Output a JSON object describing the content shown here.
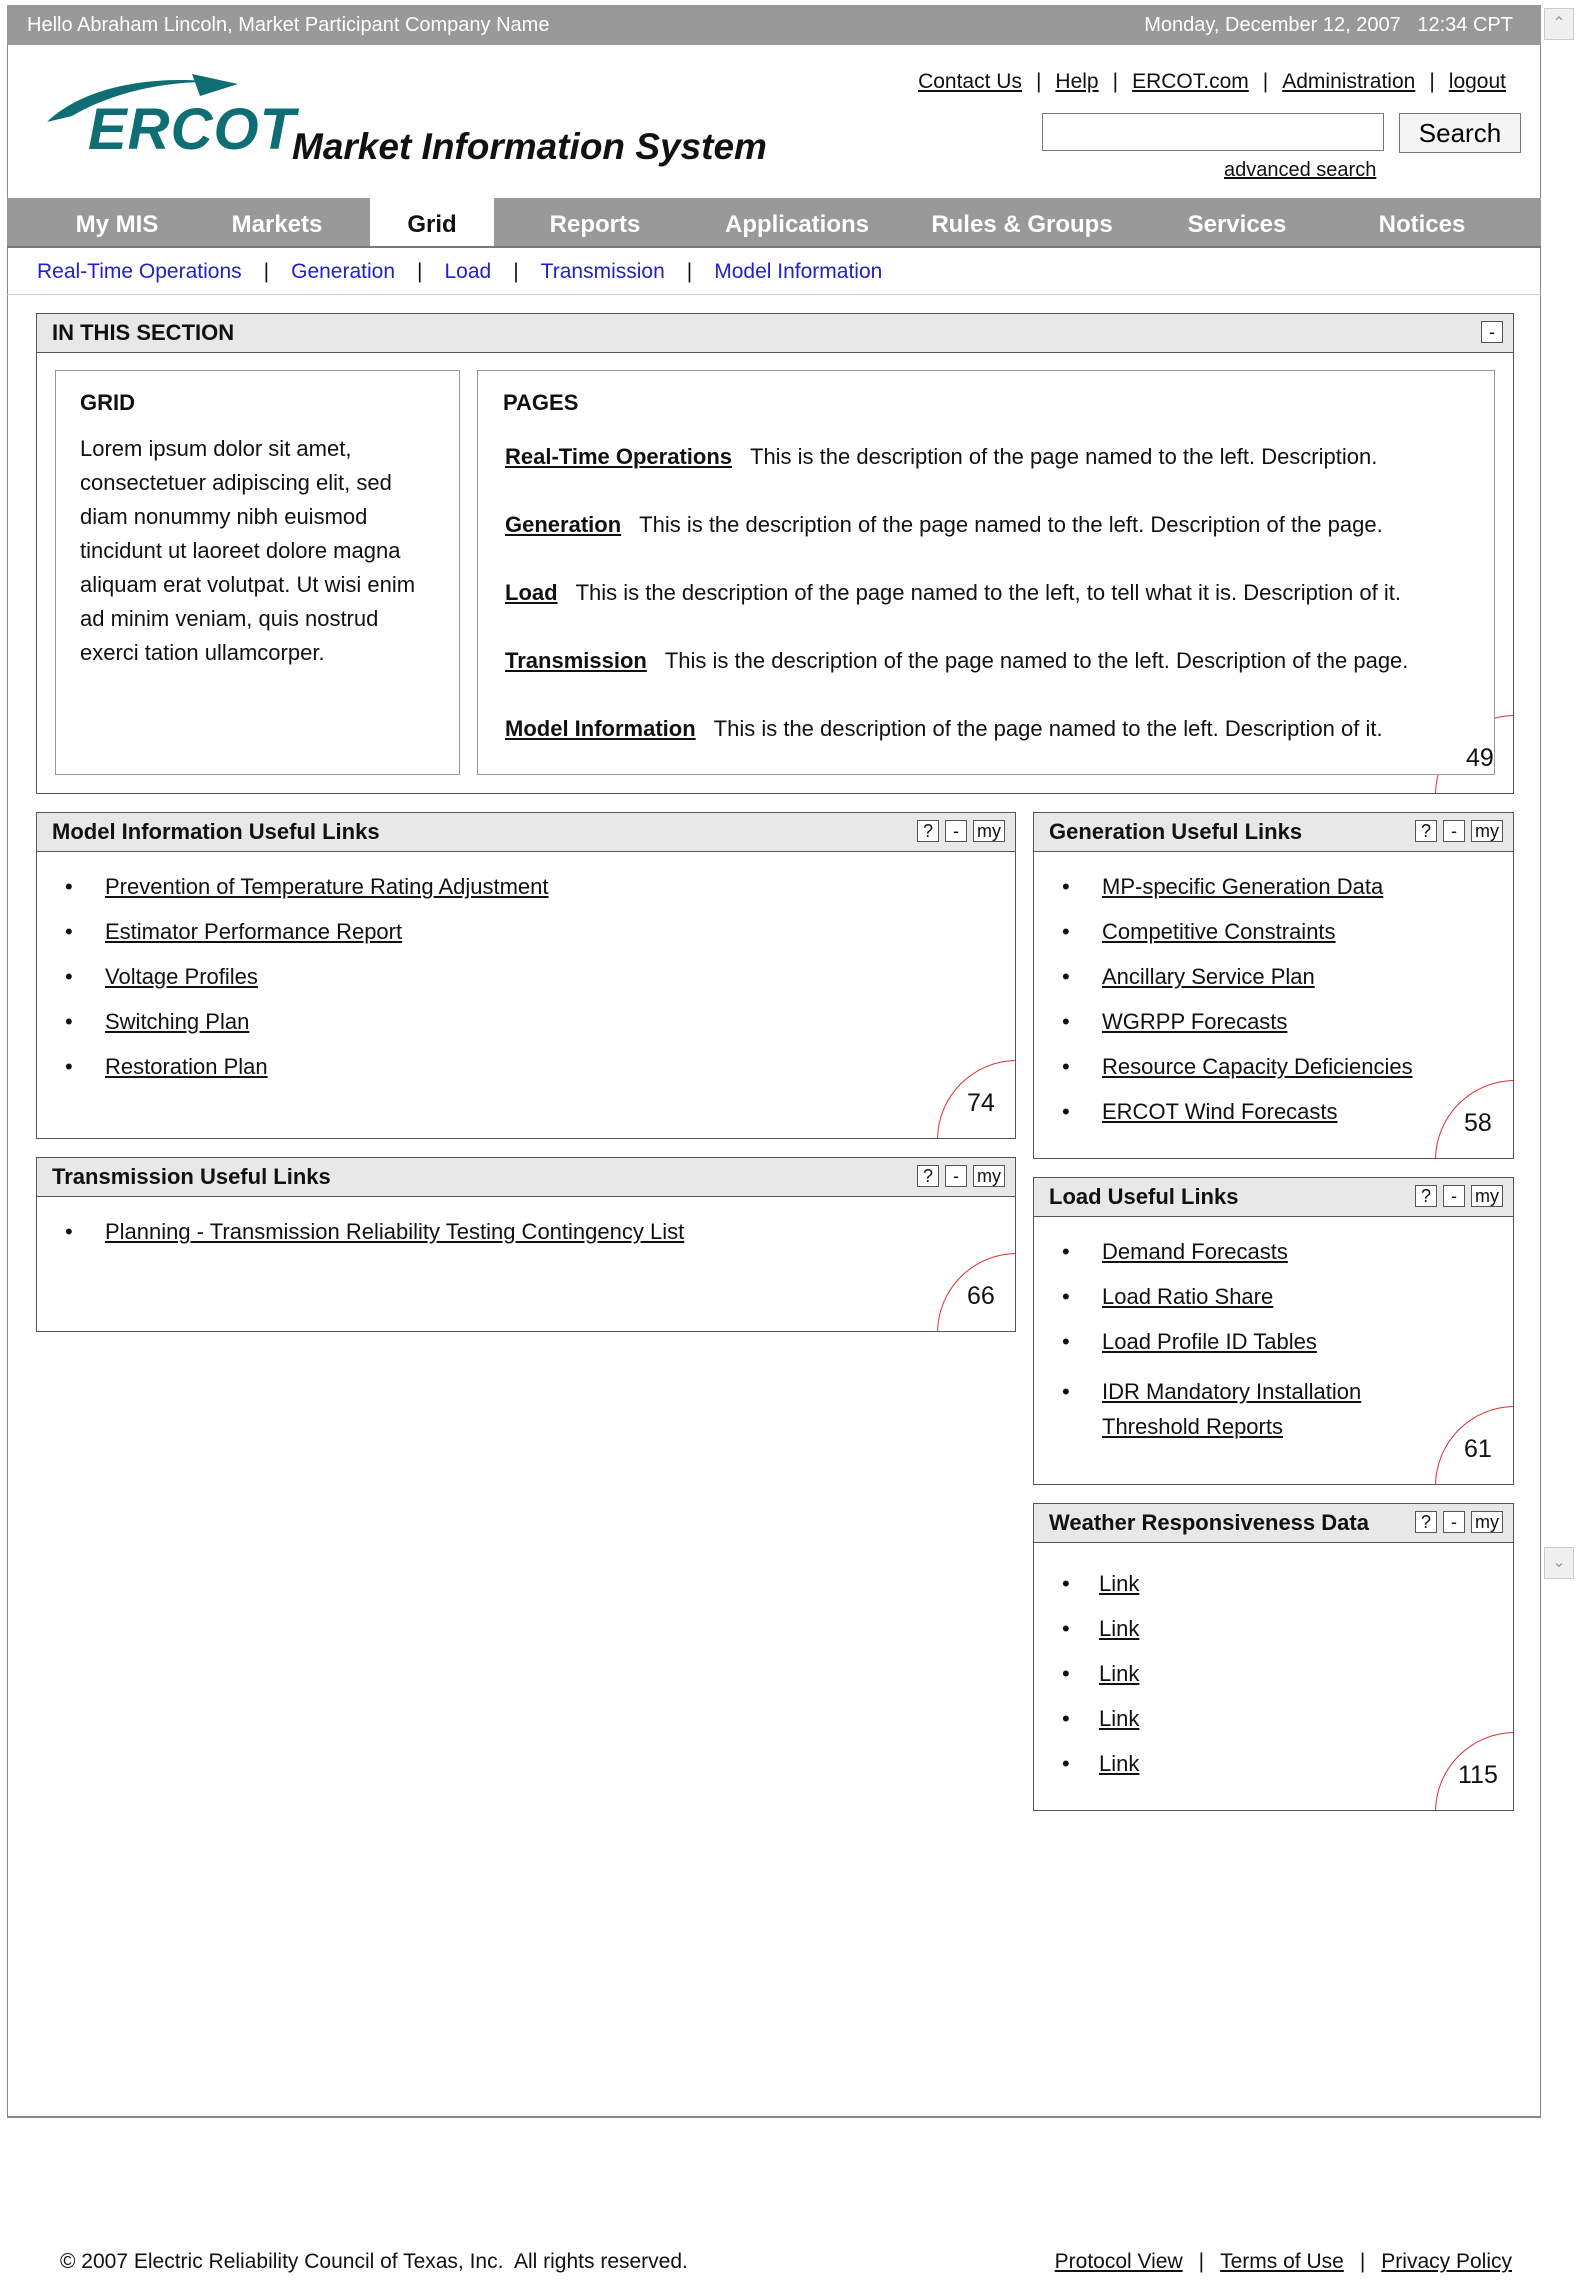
{
  "topbar": {
    "greeting": "Hello Abraham Lincoln, Market Participant Company Name",
    "datetime": "Monday, December 12, 2007   12:34 CPT"
  },
  "header": {
    "logo_text": "ERCOT",
    "title": "Market Information System",
    "utility_links": [
      "Contact Us",
      "Help",
      "ERCOT.com",
      "Administration",
      "logout"
    ],
    "search_value": "",
    "search_button": "Search",
    "advanced_search": "advanced search"
  },
  "main_nav": {
    "tabs": [
      "My MIS",
      "Markets",
      "Grid",
      "Reports",
      "Applications",
      "Rules & Groups",
      "Services",
      "Notices"
    ],
    "active": "Grid"
  },
  "sub_nav": [
    "Real-Time Operations",
    "Generation",
    "Load",
    "Transmission",
    "Model Information"
  ],
  "in_this_section": {
    "title": "IN THIS SECTION",
    "collapse": "-",
    "grid_heading": "GRID",
    "grid_text": "Lorem ipsum dolor sit amet, consectetuer adipiscing elit, sed diam nonummy nibh euismod tincidunt ut laoreet dolore magna aliquam erat volutpat. Ut wisi enim ad minim veniam, quis nostrud exerci tation ullamcorper.",
    "pages_heading": "PAGES",
    "pages": [
      {
        "name": "Real-Time Operations",
        "desc": "This is the description of the page named to the left. Description."
      },
      {
        "name": "Generation",
        "desc": "This is the description of the page named to the left. Description of the page."
      },
      {
        "name": "Load",
        "desc": "This is the description of the page named to the left, to tell what it is. Description of it."
      },
      {
        "name": "Transmission",
        "desc": "This is the description of the page named to the left. Description of the page."
      },
      {
        "name": "Model Information",
        "desc": "This is the description of the page named to the left. Description of it."
      }
    ],
    "badge": "49"
  },
  "controls": {
    "help": "?",
    "minimize": "-",
    "my": "my"
  },
  "portlets": {
    "model_info": {
      "title": "Model Information Useful Links",
      "links": [
        "Prevention of Temperature Rating Adjustment",
        "Estimator Performance Report",
        "Voltage Profiles",
        "Switching Plan",
        "Restoration Plan"
      ],
      "badge": "74"
    },
    "transmission": {
      "title": "Transmission Useful Links",
      "links": [
        "Planning - Transmission Reliability Testing Contingency List"
      ],
      "badge": "66"
    },
    "generation": {
      "title": "Generation Useful Links",
      "links": [
        "MP-specific Generation Data",
        "Competitive Constraints",
        "Ancillary Service Plan",
        "WGRPP Forecasts",
        "Resource Capacity Deficiencies",
        "ERCOT Wind Forecasts"
      ],
      "badge": "58"
    },
    "load": {
      "title": "Load Useful Links",
      "links": [
        "Demand Forecasts",
        "Load Ratio Share",
        "Load Profile ID Tables",
        "IDR Mandatory Installation Threshold Reports"
      ],
      "badge": "61"
    },
    "weather": {
      "title": "Weather Responsiveness Data",
      "links": [
        "Link",
        "Link",
        "Link",
        "Link",
        "Link"
      ],
      "badge": "115"
    }
  },
  "footer": {
    "copyright": "© 2007 Electric Reliability Council of Texas, Inc.  All rights reserved.",
    "links": [
      "Protocol View",
      "Terms of Use",
      "Privacy Policy"
    ]
  },
  "scrollbar": {
    "up_icon": "chevron-up-icon",
    "down_icon": "chevron-down-icon"
  }
}
